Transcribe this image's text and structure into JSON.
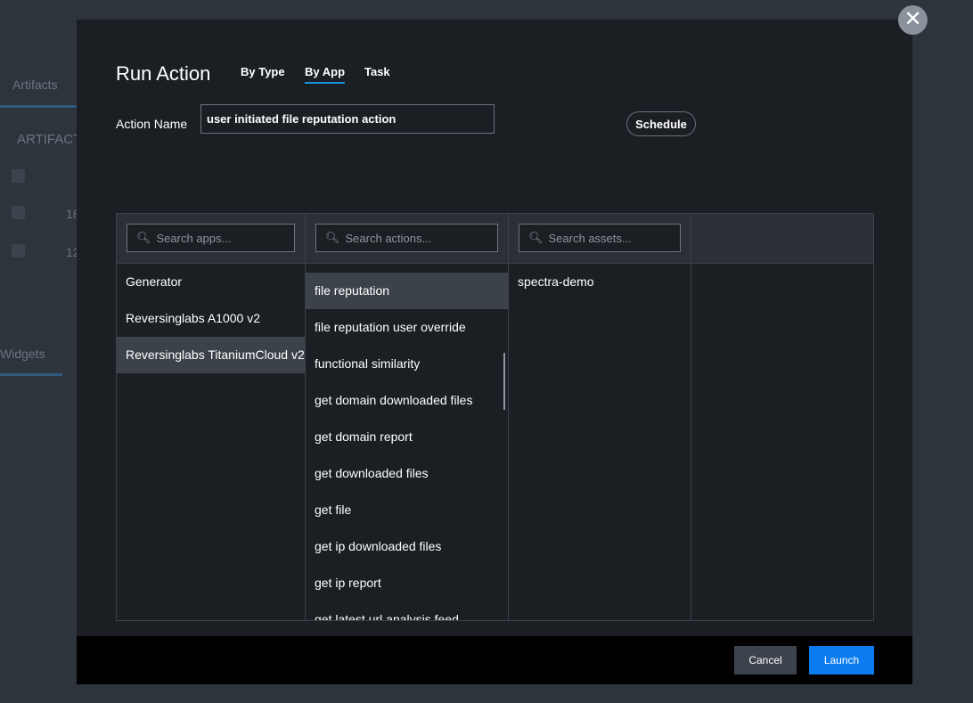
{
  "background": {
    "tab_artifacts": "Artifacts",
    "section_artifacts": "ARTIFACT",
    "row1": "18",
    "row2": "12",
    "tab_widgets": "Widgets"
  },
  "modal": {
    "title": "Run Action",
    "tabs": [
      {
        "label": "By Type"
      },
      {
        "label": "By App",
        "active": true
      },
      {
        "label": "Task"
      }
    ],
    "action_name_label": "Action Name",
    "action_name_value": "user initiated file reputation action",
    "schedule_label": "Schedule",
    "apps": {
      "placeholder": "Search apps...",
      "items": [
        "Generator",
        "Reversinglabs A1000 v2",
        "Reversinglabs TitaniumCloud v2"
      ],
      "selected": "Reversinglabs TitaniumCloud v2"
    },
    "actions": {
      "placeholder": "Search actions...",
      "items": [
        "file reputation",
        "file reputation user override",
        "functional similarity",
        "get domain downloaded files",
        "get domain report",
        "get downloaded files",
        "get file",
        "get ip downloaded files",
        "get ip report",
        "get latest url analysis feed"
      ],
      "selected": "file reputation"
    },
    "assets": {
      "placeholder": "Search assets...",
      "items": [
        "spectra-demo"
      ]
    },
    "cancel_label": "Cancel",
    "launch_label": "Launch",
    "close_icon": "close-icon",
    "accent": "#0a7cf0"
  }
}
